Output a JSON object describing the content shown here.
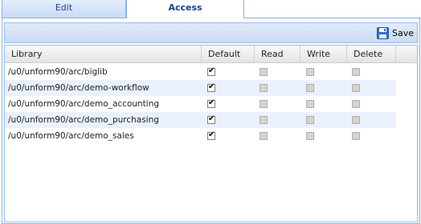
{
  "tabs": [
    {
      "label": "Edit",
      "active": false
    },
    {
      "label": "Access",
      "active": true
    }
  ],
  "toolbar": {
    "save_label": "Save"
  },
  "grid": {
    "columns": [
      "Library",
      "Default",
      "Read",
      "Write",
      "Delete"
    ],
    "rows": [
      {
        "library": "/u0/unform90/arc/biglib",
        "default": true,
        "read": false,
        "write": false,
        "delete": false
      },
      {
        "library": "/u0/unform90/arc/demo-workflow",
        "default": true,
        "read": false,
        "write": false,
        "delete": false
      },
      {
        "library": "/u0/unform90/arc/demo_accounting",
        "default": true,
        "read": false,
        "write": false,
        "delete": false
      },
      {
        "library": "/u0/unform90/arc/demo_purchasing",
        "default": true,
        "read": false,
        "write": false,
        "delete": false
      },
      {
        "library": "/u0/unform90/arc/demo_sales",
        "default": true,
        "read": false,
        "write": false,
        "delete": false
      }
    ]
  },
  "colors": {
    "border": "#8db2e3",
    "alt_row": "#eaf1fd",
    "tab_text": "#15428b"
  }
}
